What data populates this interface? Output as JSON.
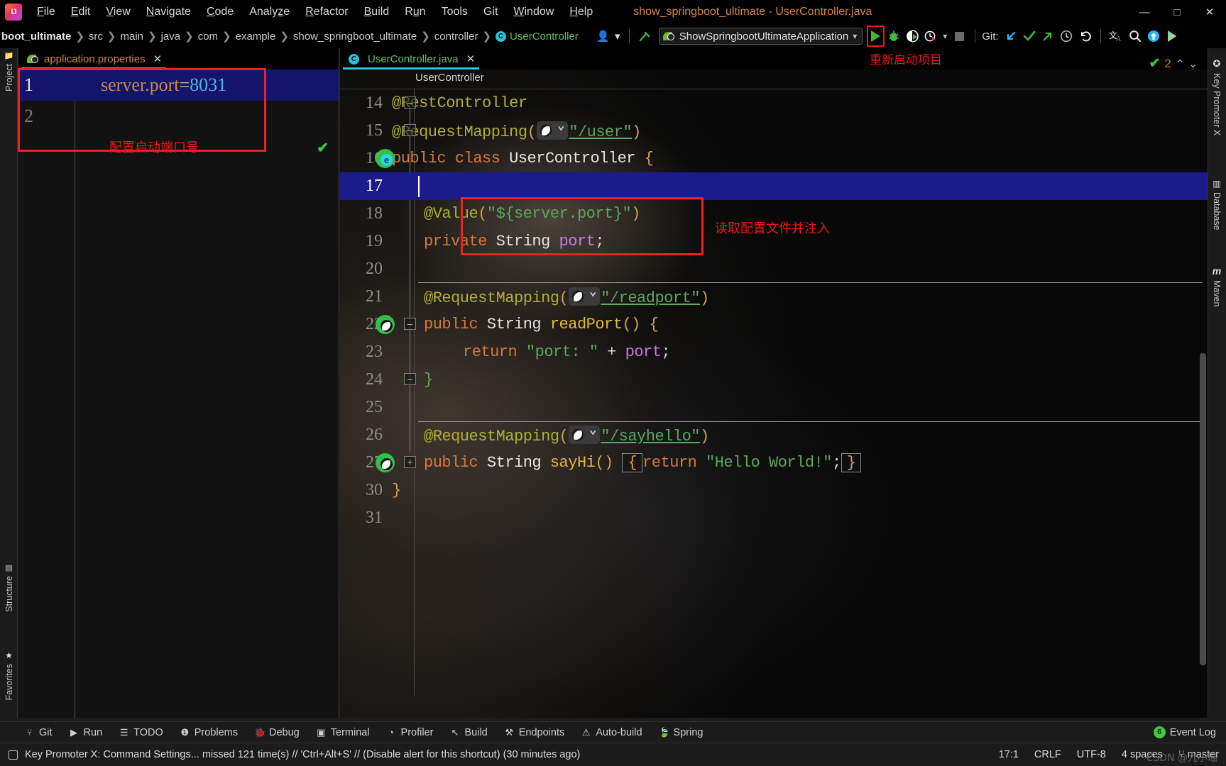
{
  "window": {
    "title": "show_springboot_ultimate - UserController.java",
    "minimize": "—",
    "maximize": "□",
    "close": "✕"
  },
  "menu": {
    "items": [
      "File",
      "Edit",
      "View",
      "Navigate",
      "Code",
      "Analyze",
      "Refactor",
      "Build",
      "Run",
      "Tools",
      "Git",
      "Window",
      "Help"
    ]
  },
  "breadcrumbs": {
    "items": [
      "boot_ultimate",
      "src",
      "main",
      "java",
      "com",
      "example",
      "show_springboot_ultimate",
      "controller",
      "UserController"
    ],
    "separator": "❯",
    "class_badge": "C"
  },
  "toolbar": {
    "run_config": "ShowSpringbootUltimateApplication",
    "run_config_caret": "▾",
    "run_button": "▶",
    "debug_button": "debug-icon",
    "run_coverage_button": "run-with-coverage-icon",
    "profiler_button": "profiler-icon",
    "profiler_caret": "▾",
    "stop_button": "■",
    "git_label": "Git:",
    "git_update": "↙",
    "git_commit": "✔",
    "git_push": "↗",
    "git_history": "🕘",
    "git_rollback": "↺",
    "translate_icon": "translate-icon",
    "search_icon": "🔍",
    "updates_icon": "↑",
    "ide_icon": "ide-icon",
    "settings_icon": "settings-icon",
    "avatar_icon": "user-icon",
    "avatar_caret": "▾"
  },
  "left_stripe": {
    "project": "Project",
    "structure": "Structure",
    "favorites": "Favorites"
  },
  "right_stripe": {
    "key_promoter": "Key Promoter X",
    "database": "Database",
    "maven": "Maven"
  },
  "left_editor": {
    "tab_name": "application.properties",
    "tab_close": "✕",
    "lines": [
      {
        "num": "1",
        "key": "server.port",
        "eq": "=",
        "value": "8031"
      },
      {
        "num": "2",
        "key": "",
        "eq": "",
        "value": ""
      }
    ],
    "annotation": "配置启动端口号",
    "ok_check": "✔"
  },
  "main_editor": {
    "tab_name": "UserController.java",
    "tab_close": "✕",
    "tab_badge": "C",
    "breadcrumb": "UserController",
    "inspection_count": "2",
    "inspection_check": "✔",
    "chevron_up": "⌃",
    "chevron_down": "⌄",
    "code_lines": [
      {
        "num": "14",
        "text": "@RestController"
      },
      {
        "num": "15",
        "text": "@RequestMapping(\"/user\")"
      },
      {
        "num": "16",
        "text": "public class UserController {"
      },
      {
        "num": "17",
        "text": ""
      },
      {
        "num": "18",
        "text": "    @Value(\"${server.port}\")"
      },
      {
        "num": "19",
        "text": "    private String port;"
      },
      {
        "num": "20",
        "text": ""
      },
      {
        "num": "21",
        "text": "    @RequestMapping(\"/readport\")"
      },
      {
        "num": "22",
        "text": "    public String readPort() {"
      },
      {
        "num": "23",
        "text": "        return \"port: \" + port;"
      },
      {
        "num": "24",
        "text": "    }"
      },
      {
        "num": "25",
        "text": ""
      },
      {
        "num": "26",
        "text": "    @RequestMapping(\"/sayhello\")"
      },
      {
        "num": "27",
        "text": "    public String sayHi() { return \"Hello World!\"; }"
      },
      {
        "num": "30",
        "text": "}"
      },
      {
        "num": "31",
        "text": ""
      }
    ],
    "tokens": {
      "rest_controller": "@RestController",
      "request_mapping": "@RequestMapping",
      "value_anno": "@Value",
      "user_path": "\"/user\"",
      "readport_path": "\"/readport\"",
      "sayhello_path": "\"/sayhello\"",
      "public": "public",
      "class": "class",
      "private": "private",
      "return": "return",
      "string_type": "String",
      "classname": "UserController",
      "port_field": "port",
      "readport_method": "readPort",
      "sayhi_method": "sayHi",
      "value_expr": "\"${server.port}\"",
      "port_str": "\"port: \"",
      "hello_str": "\"Hello World!\""
    },
    "annotation_value": "读取配置文件并注入",
    "annotation_restart": "重新启动项目"
  },
  "bottom_tools": [
    {
      "icon": "git-icon",
      "label": "Git"
    },
    {
      "icon": "run-icon",
      "label": "Run"
    },
    {
      "icon": "todo-icon",
      "label": "TODO"
    },
    {
      "icon": "problems-icon",
      "label": "Problems"
    },
    {
      "icon": "debug-icon",
      "label": "Debug"
    },
    {
      "icon": "terminal-icon",
      "label": "Terminal"
    },
    {
      "icon": "profiler-icon",
      "label": "Profiler"
    },
    {
      "icon": "build-icon",
      "label": "Build"
    },
    {
      "icon": "endpoints-icon",
      "label": "Endpoints"
    },
    {
      "icon": "autobuild-icon",
      "label": "Auto-build"
    },
    {
      "icon": "spring-icon",
      "label": "Spring"
    }
  ],
  "event_log": {
    "count": "6",
    "label": "Event Log"
  },
  "status_bar": {
    "message": "Key Promoter X: Command Settings... missed 121 time(s) // 'Ctrl+Alt+S' // (Disable alert for this shortcut) (30 minutes ago)",
    "caret_position": "17:1",
    "line_separator": "CRLF",
    "encoding": "UTF-8",
    "indent": "4 spaces",
    "branch_icon": "⑂",
    "branch": "master"
  },
  "watermark": "CSDN @九小瑶",
  "colors": {
    "accent_red": "#ef2020",
    "tab_underline": "#28c5dd",
    "run_green": "#3fb83f",
    "selection_blue": "#1b1b8c"
  }
}
